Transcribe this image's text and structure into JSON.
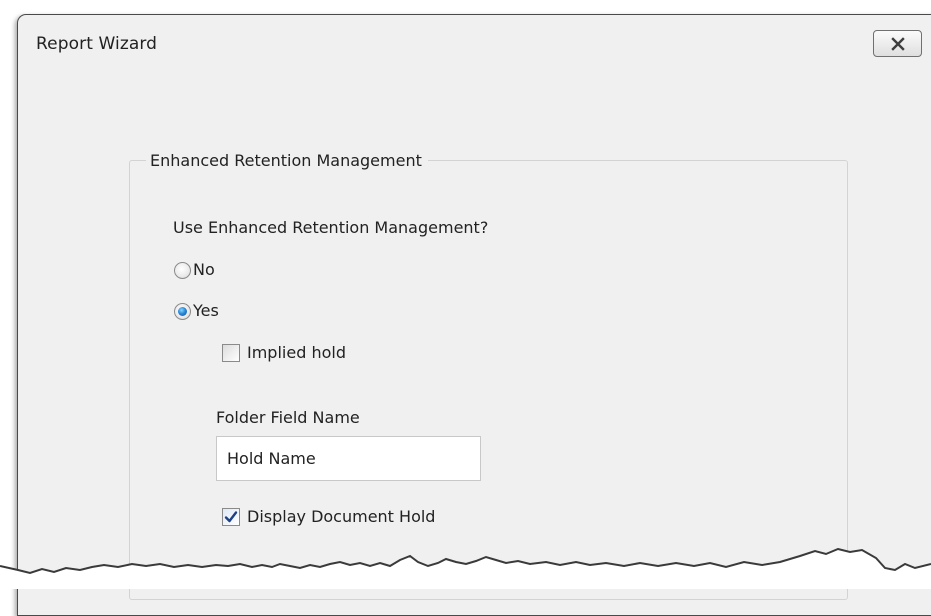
{
  "window": {
    "title": "Report Wizard"
  },
  "group": {
    "legend": "Enhanced Retention Management"
  },
  "question": "Use Enhanced Retention Management?",
  "options": [
    {
      "label": "No",
      "selected": false
    },
    {
      "label": "Yes",
      "selected": true
    }
  ],
  "implied_hold": {
    "label": "Implied hold",
    "checked": false
  },
  "folder_field": {
    "label": "Folder Field Name",
    "value": "Hold Name"
  },
  "display_hold": {
    "label": "Display Document Hold",
    "checked": true
  },
  "icons": {
    "close": "close-icon",
    "check": "checkmark-icon"
  },
  "colors": {
    "window_bg": "#f0f0f0",
    "radio_accent": "#2a8ad8",
    "check_accent": "#1f3f86"
  }
}
